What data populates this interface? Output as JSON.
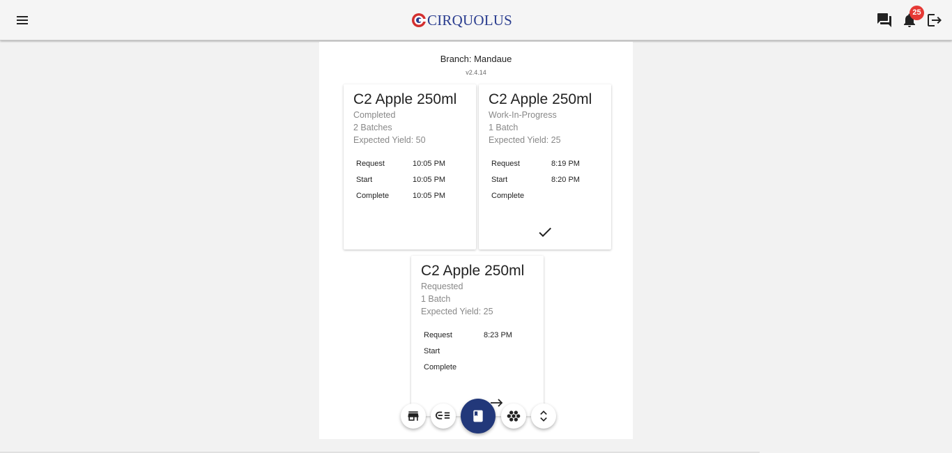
{
  "header": {
    "logo_text": "CIRQUOLUS",
    "notification_count": "25",
    "brand_color": "#2a3d8f",
    "logo_accent_color": "#d32f2f"
  },
  "branch_label": "Branch: Mandaue",
  "version": "v2.4.14",
  "cards": [
    {
      "title": "C2 Apple 250ml",
      "status": "Completed",
      "batches": "2 Batches",
      "yield": "Expected Yield: 50",
      "request_label": "Request",
      "request_time": "10:05 PM",
      "start_label": "Start",
      "start_time": "10:05 PM",
      "complete_label": "Complete",
      "complete_time": "10:05 PM"
    },
    {
      "title": "C2 Apple 250ml",
      "status": "Work-In-Progress",
      "batches": "1 Batch",
      "yield": "Expected Yield: 25",
      "request_label": "Request",
      "request_time": "8:19 PM",
      "start_label": "Start",
      "start_time": "8:20 PM",
      "complete_label": "Complete",
      "complete_time": "",
      "action_icon": "check-icon"
    },
    {
      "title": "C2 Apple 250ml",
      "status": "Requested",
      "batches": "1 Batch",
      "yield": "Expected Yield: 25",
      "request_label": "Request",
      "request_time": "8:23 PM",
      "start_label": "Start",
      "start_time": "",
      "complete_label": "Complete",
      "complete_time": "",
      "action_icon": "arrow-right-icon"
    }
  ],
  "fab_icons": [
    "store-icon",
    "list-compare-icon",
    "book-icon",
    "cluster-icon",
    "unfold-icon"
  ],
  "fab_main_color": "#22387a"
}
